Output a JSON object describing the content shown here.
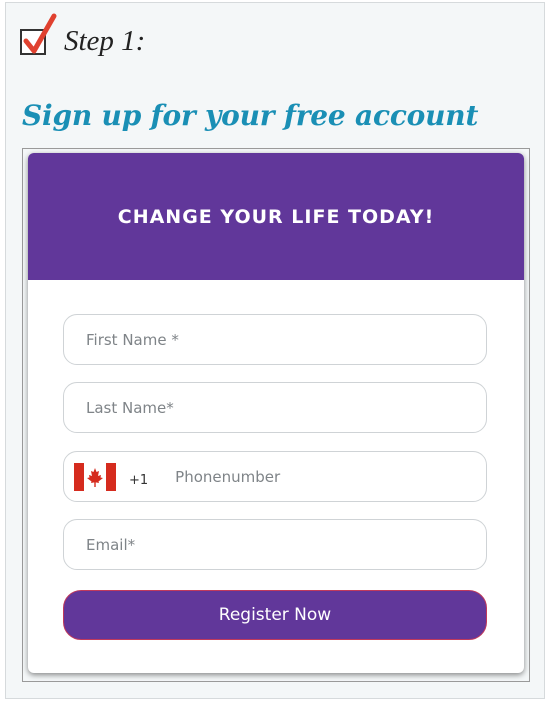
{
  "step": {
    "label": "Step 1:",
    "check_icon": "checkbox-checked-icon"
  },
  "headline": "Sign up for your free account",
  "form": {
    "title": "CHANGE YOUR LIFE TODAY!",
    "first_name_placeholder": "First Name *",
    "last_name_placeholder": "Last Name*",
    "phone": {
      "country_flag": "canada-flag-icon",
      "dial_code": "+1",
      "placeholder": "Phonenumber"
    },
    "email_placeholder": "Email*",
    "submit_label": "Register Now"
  },
  "colors": {
    "header_bg": "#61379a",
    "button_bg": "#61379a",
    "headline": "#1a8fb5",
    "check_mark": "#e0412f",
    "flag_red": "#d52b1e"
  }
}
